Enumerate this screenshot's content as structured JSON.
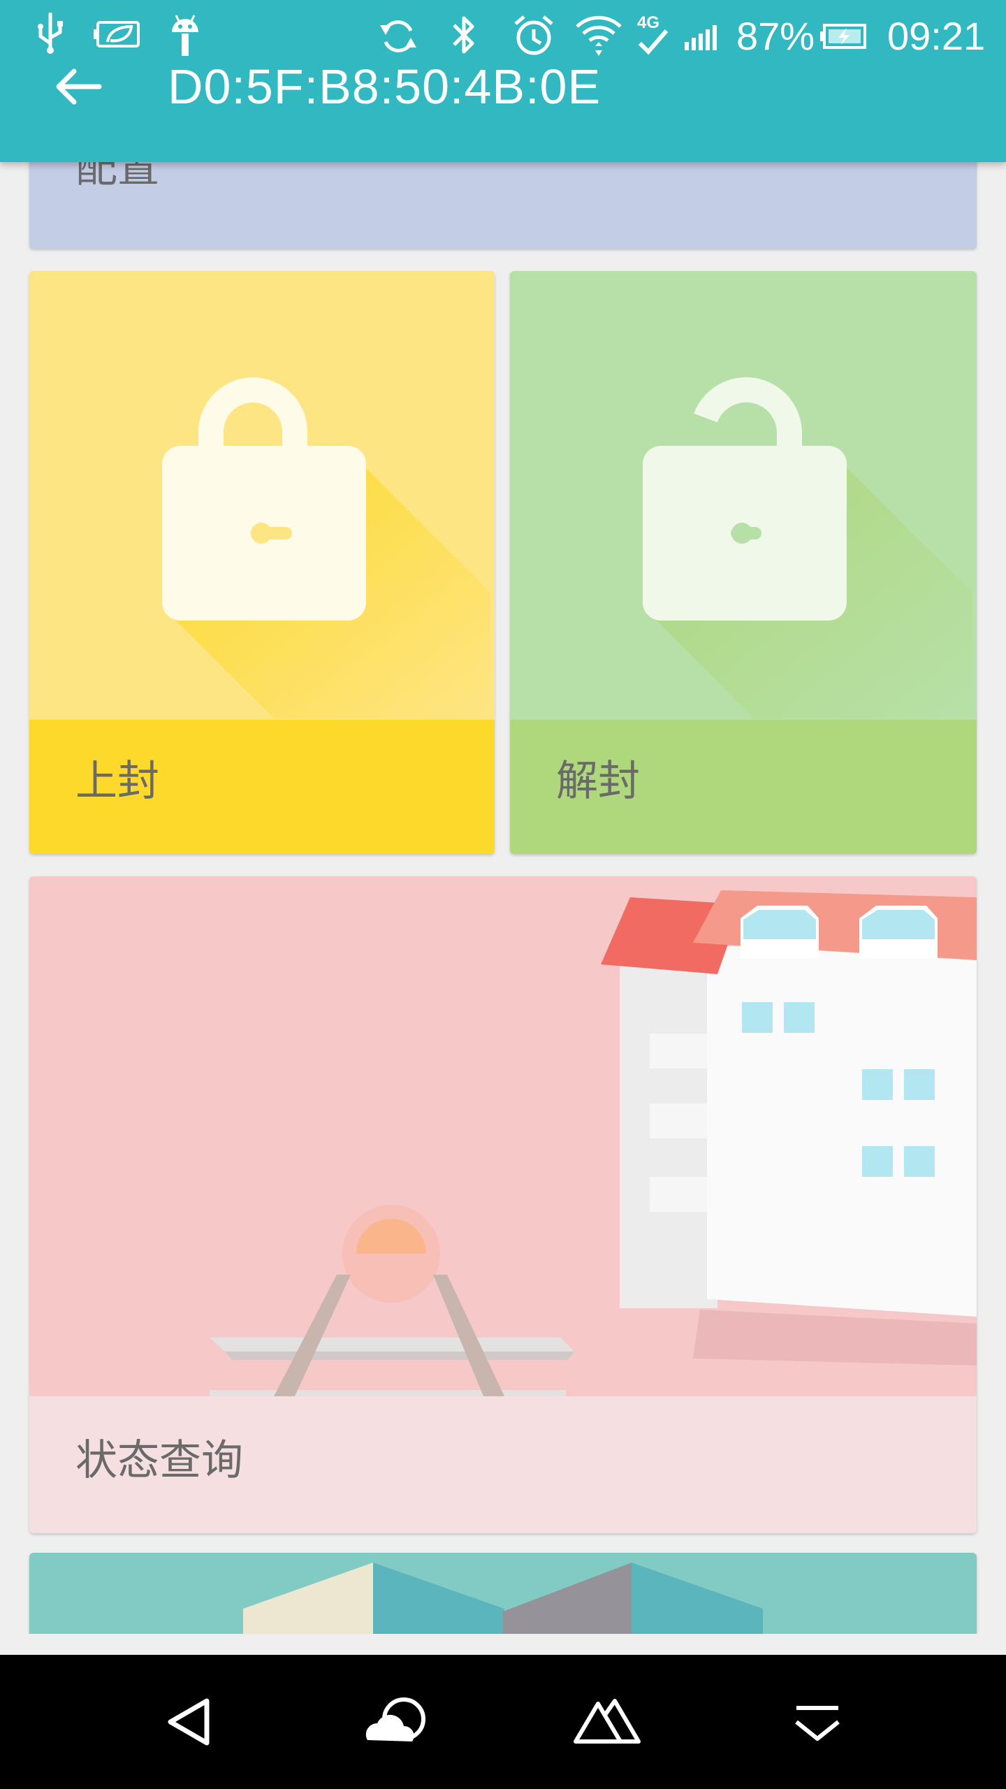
{
  "status_bar": {
    "battery_percent": "87%",
    "time": "09:21",
    "network": "4G",
    "icons": [
      "usb-icon",
      "battery-saver-icon",
      "android-debug-icon",
      "sync-icon",
      "bluetooth-icon",
      "alarm-icon",
      "wifi-icon",
      "network-4g-icon",
      "signal-icon",
      "battery-charging-icon"
    ]
  },
  "app_bar": {
    "title": "D0:5F:B8:50:4B:0E",
    "back_icon": "arrow-back-icon"
  },
  "cards": {
    "config": {
      "label": "配置",
      "color": "#c4cde6"
    },
    "seal": {
      "label": "上封",
      "top_color": "#fee584",
      "bottom_color": "#fcd92b",
      "icon": "lock-closed-icon"
    },
    "unseal": {
      "label": "解封",
      "top_color": "#b7e0a8",
      "bottom_color": "#afd77c",
      "icon": "lock-open-icon"
    },
    "status": {
      "label": "状态查询",
      "top_color": "#f6c8c8",
      "bottom_color": "#f5dfe0",
      "icon": "building-illustration"
    },
    "next": {
      "color": "#82cbc4",
      "icon": "buildings-illustration"
    }
  },
  "nav_bar": {
    "buttons": [
      "back-triangle-icon",
      "cloud-icon",
      "mountains-icon",
      "notification-down-icon"
    ]
  }
}
